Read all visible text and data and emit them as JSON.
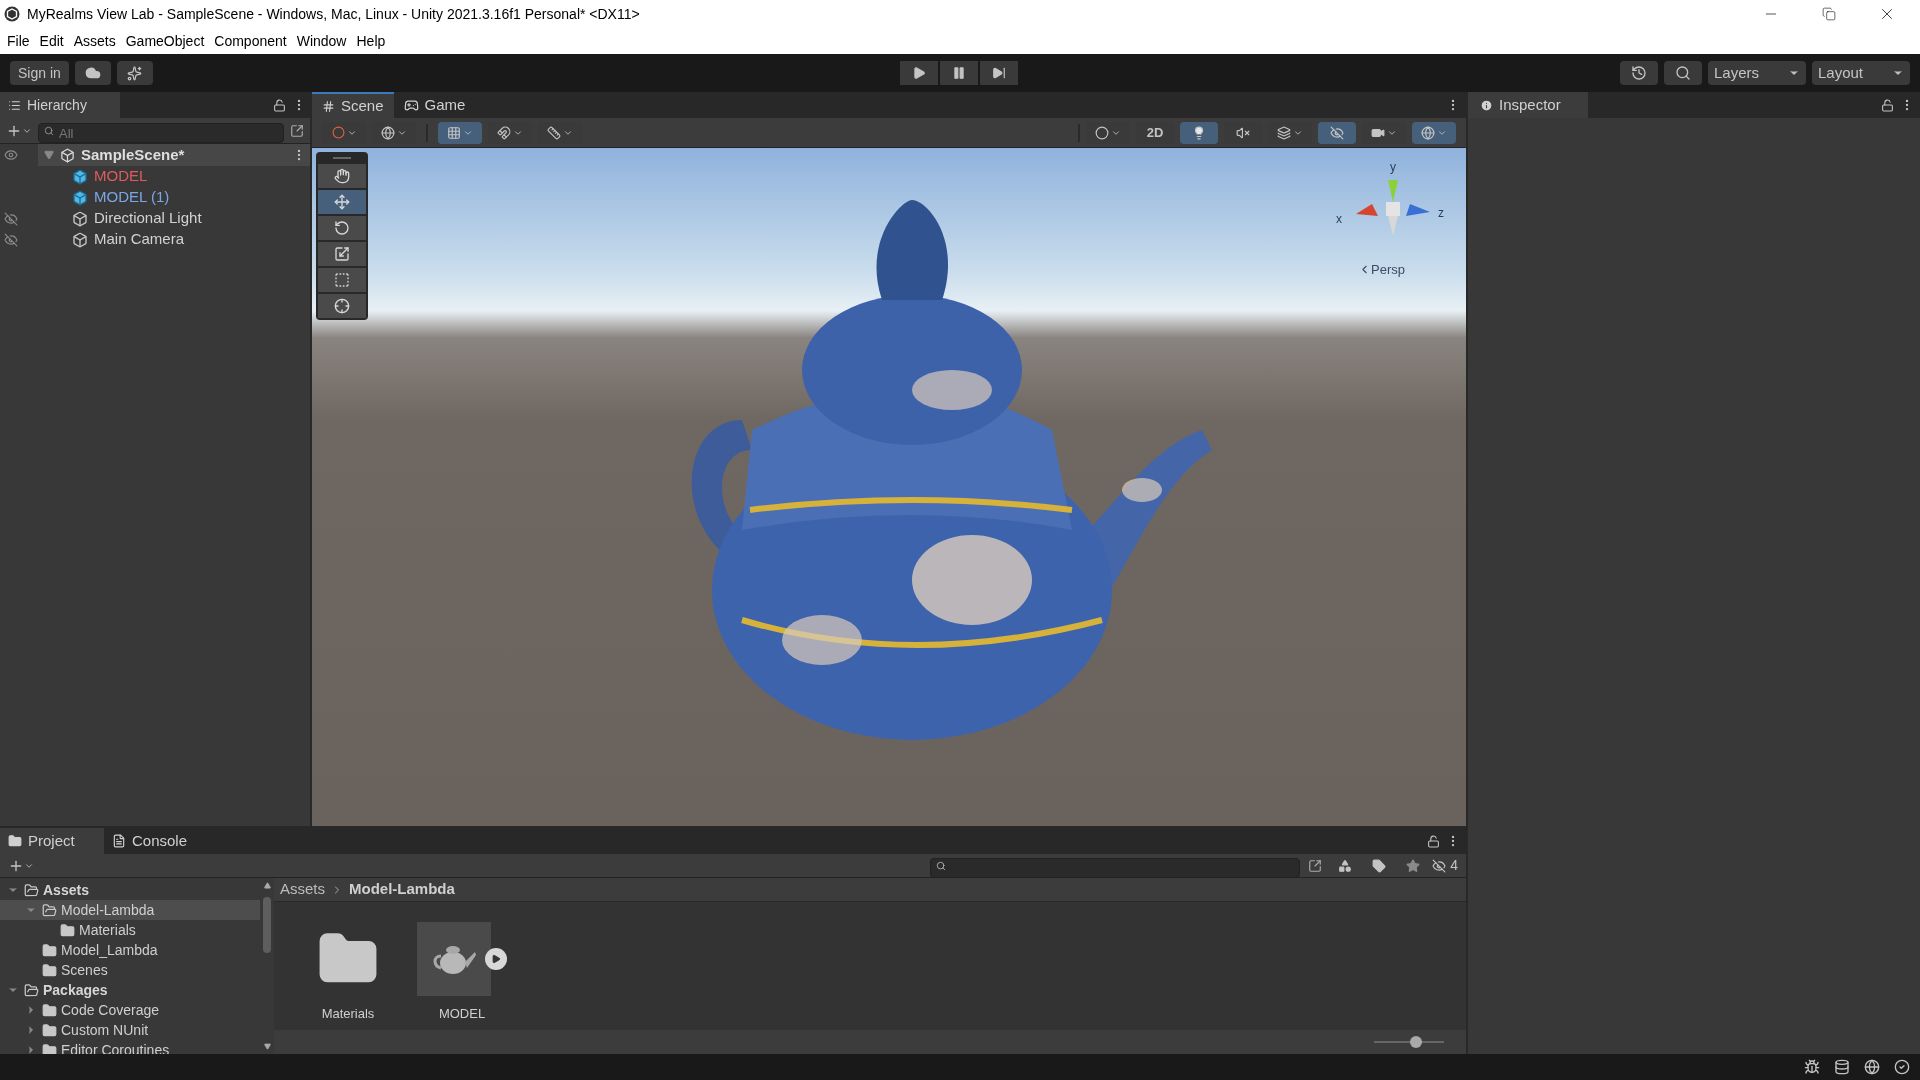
{
  "window": {
    "title": "MyRealms View Lab - SampleScene - Windows, Mac, Linux - Unity 2021.3.16f1 Personal* <DX11>"
  },
  "menu": [
    "File",
    "Edit",
    "Assets",
    "GameObject",
    "Component",
    "Window",
    "Help"
  ],
  "toolbar": {
    "sign_in": "Sign in",
    "layers": "Layers",
    "layout": "Layout"
  },
  "hierarchy": {
    "title": "Hierarchy",
    "search_placeholder": "All",
    "scene": {
      "label": "SampleScene*",
      "expanded": true
    },
    "items": [
      {
        "label": "MODEL",
        "kind": "prefab",
        "color": "#e05c5c",
        "hidden": false
      },
      {
        "label": "MODEL (1)",
        "kind": "prefab",
        "color": "#7ba7e6",
        "hidden": false
      },
      {
        "label": "Directional Light",
        "kind": "object",
        "color": "#d2d2d2",
        "hidden": true
      },
      {
        "label": "Main Camera",
        "kind": "object",
        "color": "#d2d2d2",
        "hidden": true
      }
    ]
  },
  "scene_tabs": [
    {
      "label": "Scene",
      "kind": "scene",
      "selected": true
    },
    {
      "label": "Game",
      "kind": "game",
      "selected": false
    }
  ],
  "scene_toolbar": {
    "grid_snap": true,
    "mode_2d": "2D",
    "mode_2d_on": false,
    "lighting": true,
    "audio": false,
    "hidden_objects": true,
    "gizmos": true
  },
  "scene_tools": [
    {
      "kind": "hand",
      "selected": false
    },
    {
      "kind": "move",
      "selected": true
    },
    {
      "kind": "rotate",
      "selected": false
    },
    {
      "kind": "scale",
      "selected": false
    },
    {
      "kind": "rect",
      "selected": false
    },
    {
      "kind": "transform",
      "selected": false
    }
  ],
  "gizmo": {
    "y": "y",
    "x": "x",
    "z": "z",
    "projection": "Persp"
  },
  "inspector": {
    "title": "Inspector"
  },
  "bottom_tabs": [
    {
      "label": "Project",
      "kind": "project",
      "selected": true
    },
    {
      "label": "Console",
      "kind": "console",
      "selected": false
    }
  ],
  "project": {
    "hidden_count": "4",
    "zoom": {
      "level": 0.6
    },
    "tree": [
      {
        "label": "Assets",
        "expanded": true,
        "selected": false,
        "children": [
          {
            "label": "Model-Lambda",
            "expanded": true,
            "selected": true,
            "children": [
              {
                "label": "Materials",
                "expanded": false,
                "selected": false
              }
            ]
          },
          {
            "label": "Model_Lambda",
            "expanded": false,
            "selected": false
          },
          {
            "label": "Scenes",
            "expanded": false,
            "selected": false
          }
        ]
      },
      {
        "label": "Packages",
        "expanded": true,
        "selected": false,
        "children": [
          {
            "label": "Code Coverage",
            "expanded": false,
            "selected": false,
            "has_children": true
          },
          {
            "label": "Custom NUnit",
            "expanded": false,
            "selected": false,
            "has_children": true
          },
          {
            "label": "Editor Coroutines",
            "expanded": false,
            "selected": false,
            "has_children": true
          }
        ]
      }
    ],
    "breadcrumb": [
      "Assets",
      "Model-Lambda"
    ],
    "assets": [
      {
        "label": "Materials",
        "kind": "folder"
      },
      {
        "label": "MODEL",
        "kind": "model"
      }
    ]
  }
}
